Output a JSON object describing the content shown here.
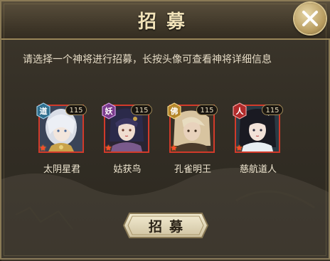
{
  "dialog": {
    "title": "招募",
    "instruction": "请选择一个神将进行招募，长按头像可查看神将详细信息"
  },
  "heroes": [
    {
      "name": "太阴星君",
      "faction": "道",
      "faction_color": "#2f6f8f",
      "level": "115",
      "stars": 1
    },
    {
      "name": "姑获鸟",
      "faction": "妖",
      "faction_color": "#7a3a8c",
      "level": "115",
      "stars": 1
    },
    {
      "name": "孔雀明王",
      "faction": "佛",
      "faction_color": "#b5862a",
      "level": "115",
      "stars": 1
    },
    {
      "name": "慈航道人",
      "faction": "人",
      "faction_color": "#b02a2a",
      "level": "115",
      "stars": 1
    }
  ],
  "buttons": {
    "recruit_label": "招募"
  },
  "icons": {
    "close": "close-x-icon",
    "star": "star-icon"
  }
}
